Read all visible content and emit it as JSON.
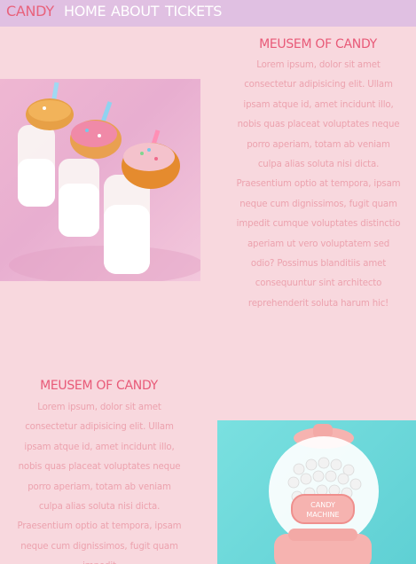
{
  "nav": {
    "brand": "CANDY",
    "home": "HOME",
    "about": "ABOUT",
    "tickets": "TICKETS"
  },
  "sections": [
    {
      "title": "MEUSEM OF CANDY",
      "text": "Lorem ipsum, dolor sit amet consectetur adipisicing elit. Ullam ipsam atque id, amet incidunt illo, nobis quas placeat voluptates neque porro aperiam, totam ab veniam culpa alias soluta nisi dicta. Praesentium optio at tempora, ipsam neque cum dignissimos, fugit quam impedit cumque voluptates distinctio aperiam ut vero voluptatem sed odio? Possimus blanditiis amet consequuntur sint architecto reprehenderit soluta harum hic!",
      "image_icon": "donuts-on-milk-bottles-photo"
    },
    {
      "title": "MEUSEM OF CANDY",
      "text": "Lorem ipsum, dolor sit amet consectetur adipisicing elit. Ullam ipsam atque id, amet incidunt illo, nobis quas placeat voluptates neque porro aperiam, totam ab veniam culpa alias soluta nisi dicta. Praesentium optio at tempora, ipsam neque cum dignissimos, fugit quam impedit",
      "image_icon": "candy-machine-photo",
      "image_label_1": "CANDY",
      "image_label_2": "MACHINE"
    }
  ],
  "colors": {
    "background": "#f8d8de",
    "nav_background": "#e0c0e2",
    "brand": "#e8627c",
    "title": "#e85a78",
    "text": "#eca2ae"
  }
}
